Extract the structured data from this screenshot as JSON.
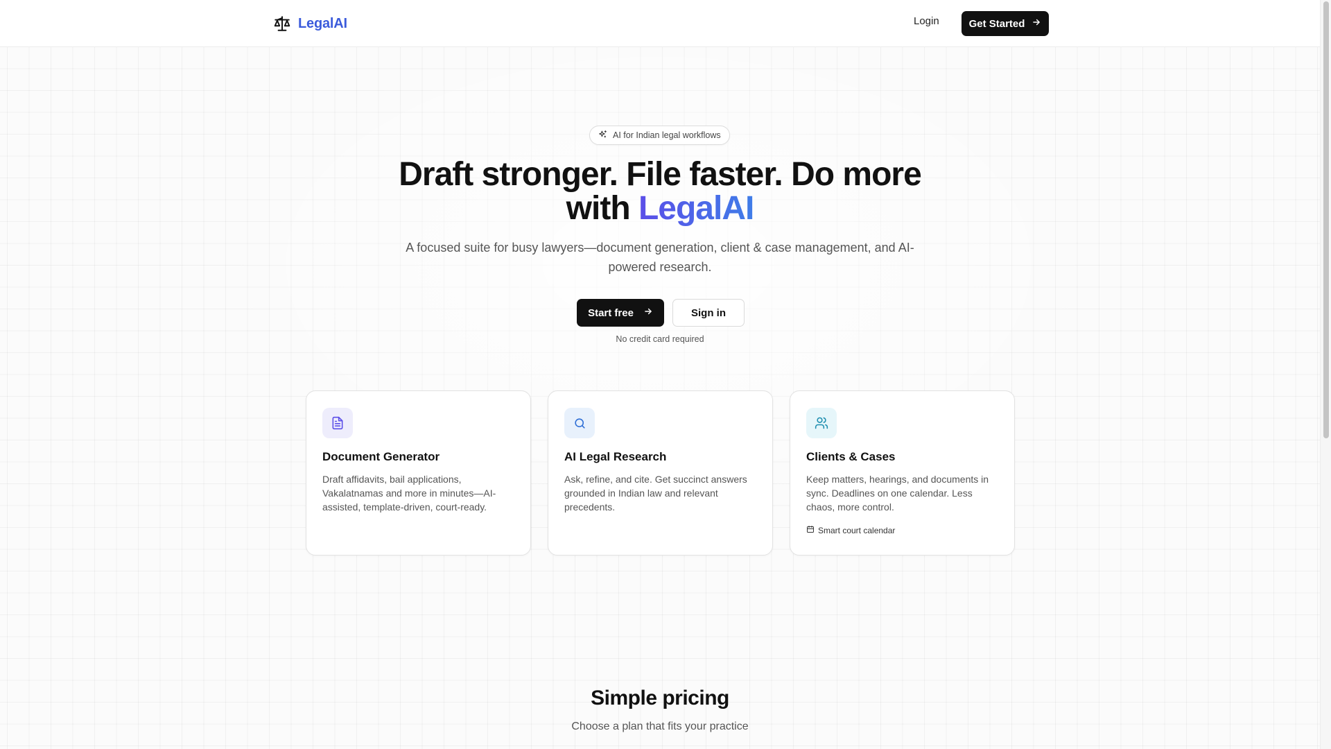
{
  "header": {
    "brand_name": "LegalAI",
    "login_label": "Login",
    "get_started_label": "Get Started"
  },
  "hero": {
    "badge_text": "AI for Indian legal workflows",
    "headline_part1": "Draft stronger. File faster. Do more with ",
    "headline_accent": "LegalAI",
    "subtitle": "A focused suite for busy lawyers—document generation, client & case management, and AI-powered research.",
    "start_free_label": "Start free",
    "sign_in_label": "Sign in",
    "note": "No credit card required"
  },
  "features": [
    {
      "icon": "document-icon",
      "title": "Document Generator",
      "description": "Draft affidavits, bail applications, Vakalatnamas and more in minutes—AI-assisted, template-driven, court-ready.",
      "icon_bg": "#eeedfc",
      "icon_color": "#5b4ee8"
    },
    {
      "icon": "search-icon",
      "title": "AI Legal Research",
      "description": "Ask, refine, and cite. Get succinct answers grounded in Indian law and relevant precedents.",
      "icon_bg": "#e8f1fc",
      "icon_color": "#2f6fd6"
    },
    {
      "icon": "users-icon",
      "title": "Clients & Cases",
      "description": "Keep matters, hearings, and documents in sync. Deadlines on one calendar. Less chaos, more control.",
      "extra": "Smart court calendar",
      "extra_icon": "calendar-icon",
      "icon_bg": "#e6f6fa",
      "icon_color": "#1f8fb0"
    }
  ],
  "pricing": {
    "title": "Simple pricing",
    "subtitle": "Choose a plan that fits your practice"
  },
  "colors": {
    "brand": "#3b5bdb",
    "accent_gradient_start": "#5b4ee8",
    "accent_gradient_end": "#3f7de8",
    "primary_button": "#111111"
  }
}
